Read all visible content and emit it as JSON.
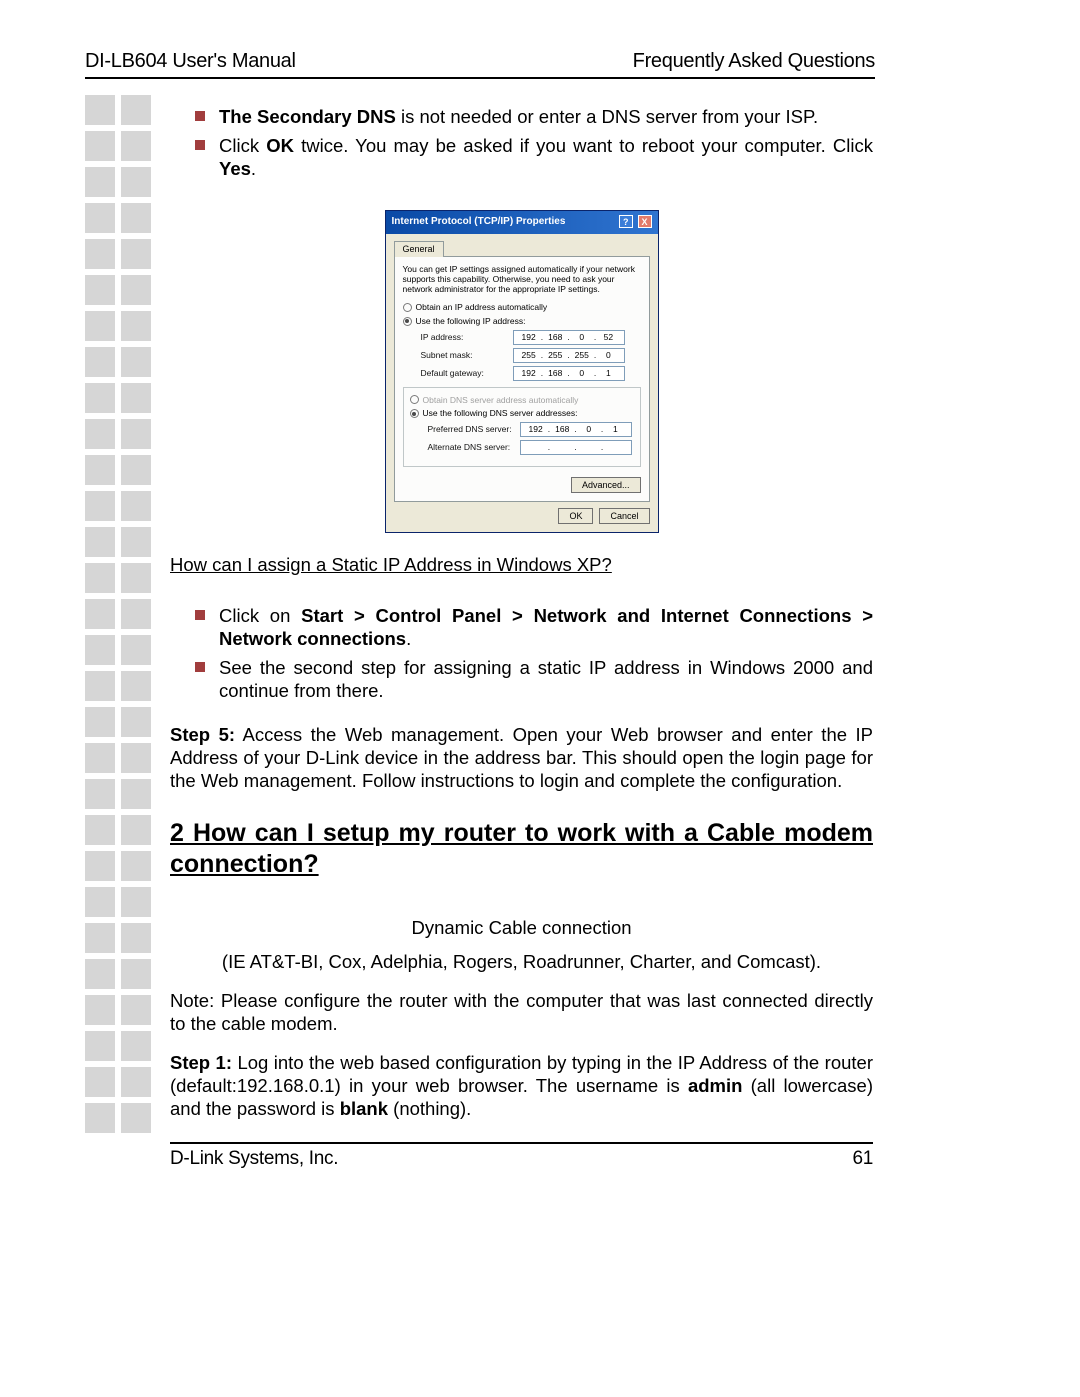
{
  "header": {
    "left": "DI-LB604 User's Manual",
    "right": "Frequently Asked Questions"
  },
  "bullets1": [
    {
      "pre": "",
      "bold1": "The Secondary DNS",
      "mid": " is not needed or enter a DNS server from your ISP.",
      "post": ""
    },
    {
      "pre": "Click ",
      "bold1": "OK",
      "mid": " twice. You may be asked if you want to reboot your computer. Click ",
      "bold2": "Yes",
      "post": "."
    }
  ],
  "dialog": {
    "title": "Internet Protocol (TCP/IP) Properties",
    "tab": "General",
    "desc": "You can get IP settings assigned automatically if your network supports this capability. Otherwise, you need to ask your network administrator for the appropriate IP settings.",
    "r1": "Obtain an IP address automatically",
    "r2": "Use the following IP address:",
    "lbl_ip": "IP address:",
    "lbl_mask": "Subnet mask:",
    "lbl_gw": "Default gateway:",
    "r3": "Obtain DNS server address automatically",
    "r4": "Use the following DNS server addresses:",
    "lbl_pdns": "Preferred DNS server:",
    "lbl_adns": "Alternate DNS server:",
    "ip": [
      "192",
      "168",
      "0",
      "52"
    ],
    "mask": [
      "255",
      "255",
      "255",
      "0"
    ],
    "gw": [
      "192",
      "168",
      "0",
      "1"
    ],
    "pdns": [
      "192",
      "168",
      "0",
      "1"
    ],
    "adns": [
      "",
      "",
      "",
      ""
    ],
    "btn_adv": "Advanced...",
    "btn_ok": "OK",
    "btn_cancel": "Cancel"
  },
  "q_xp": "How can I assign a Static IP Address in Windows XP?",
  "bullets2": [
    {
      "pre": "Click on ",
      "bold1": "Start > Control Panel > Network and Internet Connections > Network connections",
      "post": "."
    },
    {
      "pre": "See the second step for assigning a static IP address in Windows 2000 and continue from there.",
      "bold1": "",
      "post": ""
    }
  ],
  "step5": {
    "label": "Step 5:",
    "text": " Access the Web management. Open your Web browser and enter the IP Address of your D-Link device in the address bar. This should open the login page for the Web management. Follow instructions to login and complete the configuration."
  },
  "section2": "2 How can I setup my router to work with a Cable modem connection?",
  "dyn_title": "Dynamic Cable connection",
  "dyn_sub": "(IE AT&T-BI, Cox, Adelphia, Rogers, Roadrunner, Charter, and Comcast).",
  "note": "Note: Please configure the router with the computer that was last connected directly to the cable modem.",
  "step1": {
    "label": "Step 1:",
    "t1": " Log into the web based configuration by typing in the IP Address of the router (default:192.168.0.1) in your web browser. The username is ",
    "b1": "admin",
    "t2": " (all lowercase) and the password is ",
    "b2": "blank",
    "t3": " (nothing)."
  },
  "footer": {
    "left": "D-Link Systems, Inc.",
    "right": "61"
  }
}
